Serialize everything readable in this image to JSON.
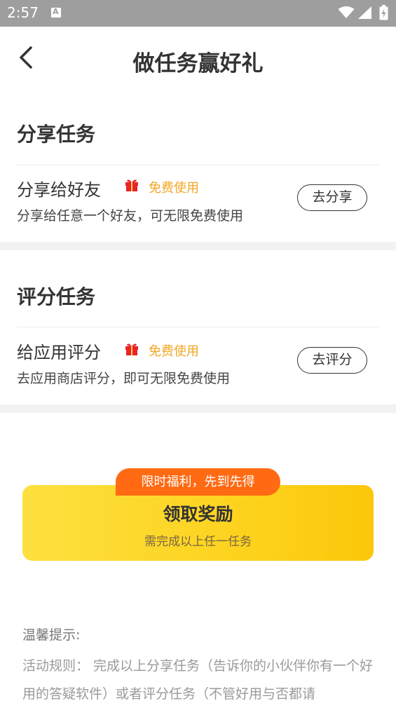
{
  "status_bar": {
    "time": "2:57",
    "notification_icon_letter": "A"
  },
  "header": {
    "title": "做任务赢好礼",
    "back_icon": "chevron-left-icon"
  },
  "sections": [
    {
      "title": "分享任务",
      "task": {
        "name": "分享给好友",
        "tag": "免费使用",
        "description": "分享给任意一个好友，可无限免费使用",
        "button_label": "去分享"
      }
    },
    {
      "title": "评分任务",
      "task": {
        "name": "给应用评分",
        "tag": "免费使用",
        "description": "去应用商店评分，即可无限免费使用",
        "button_label": "去评分"
      }
    }
  ],
  "reward": {
    "badge": "限时福利，先到先得",
    "title": "领取奖励",
    "subtitle": "需完成以上任一任务"
  },
  "tips": {
    "title": "温馨提示:",
    "body": "活动规则：  完成以上分享任务（告诉你的小伙伴你有一个好用的答疑软件）或者评分任务（不管好用与否都请"
  },
  "colors": {
    "accent_orange": "#ff6a13",
    "tag_color": "#f5a623",
    "reward_yellow": "#fdd31f",
    "status_bar": "#9e9e9e"
  }
}
